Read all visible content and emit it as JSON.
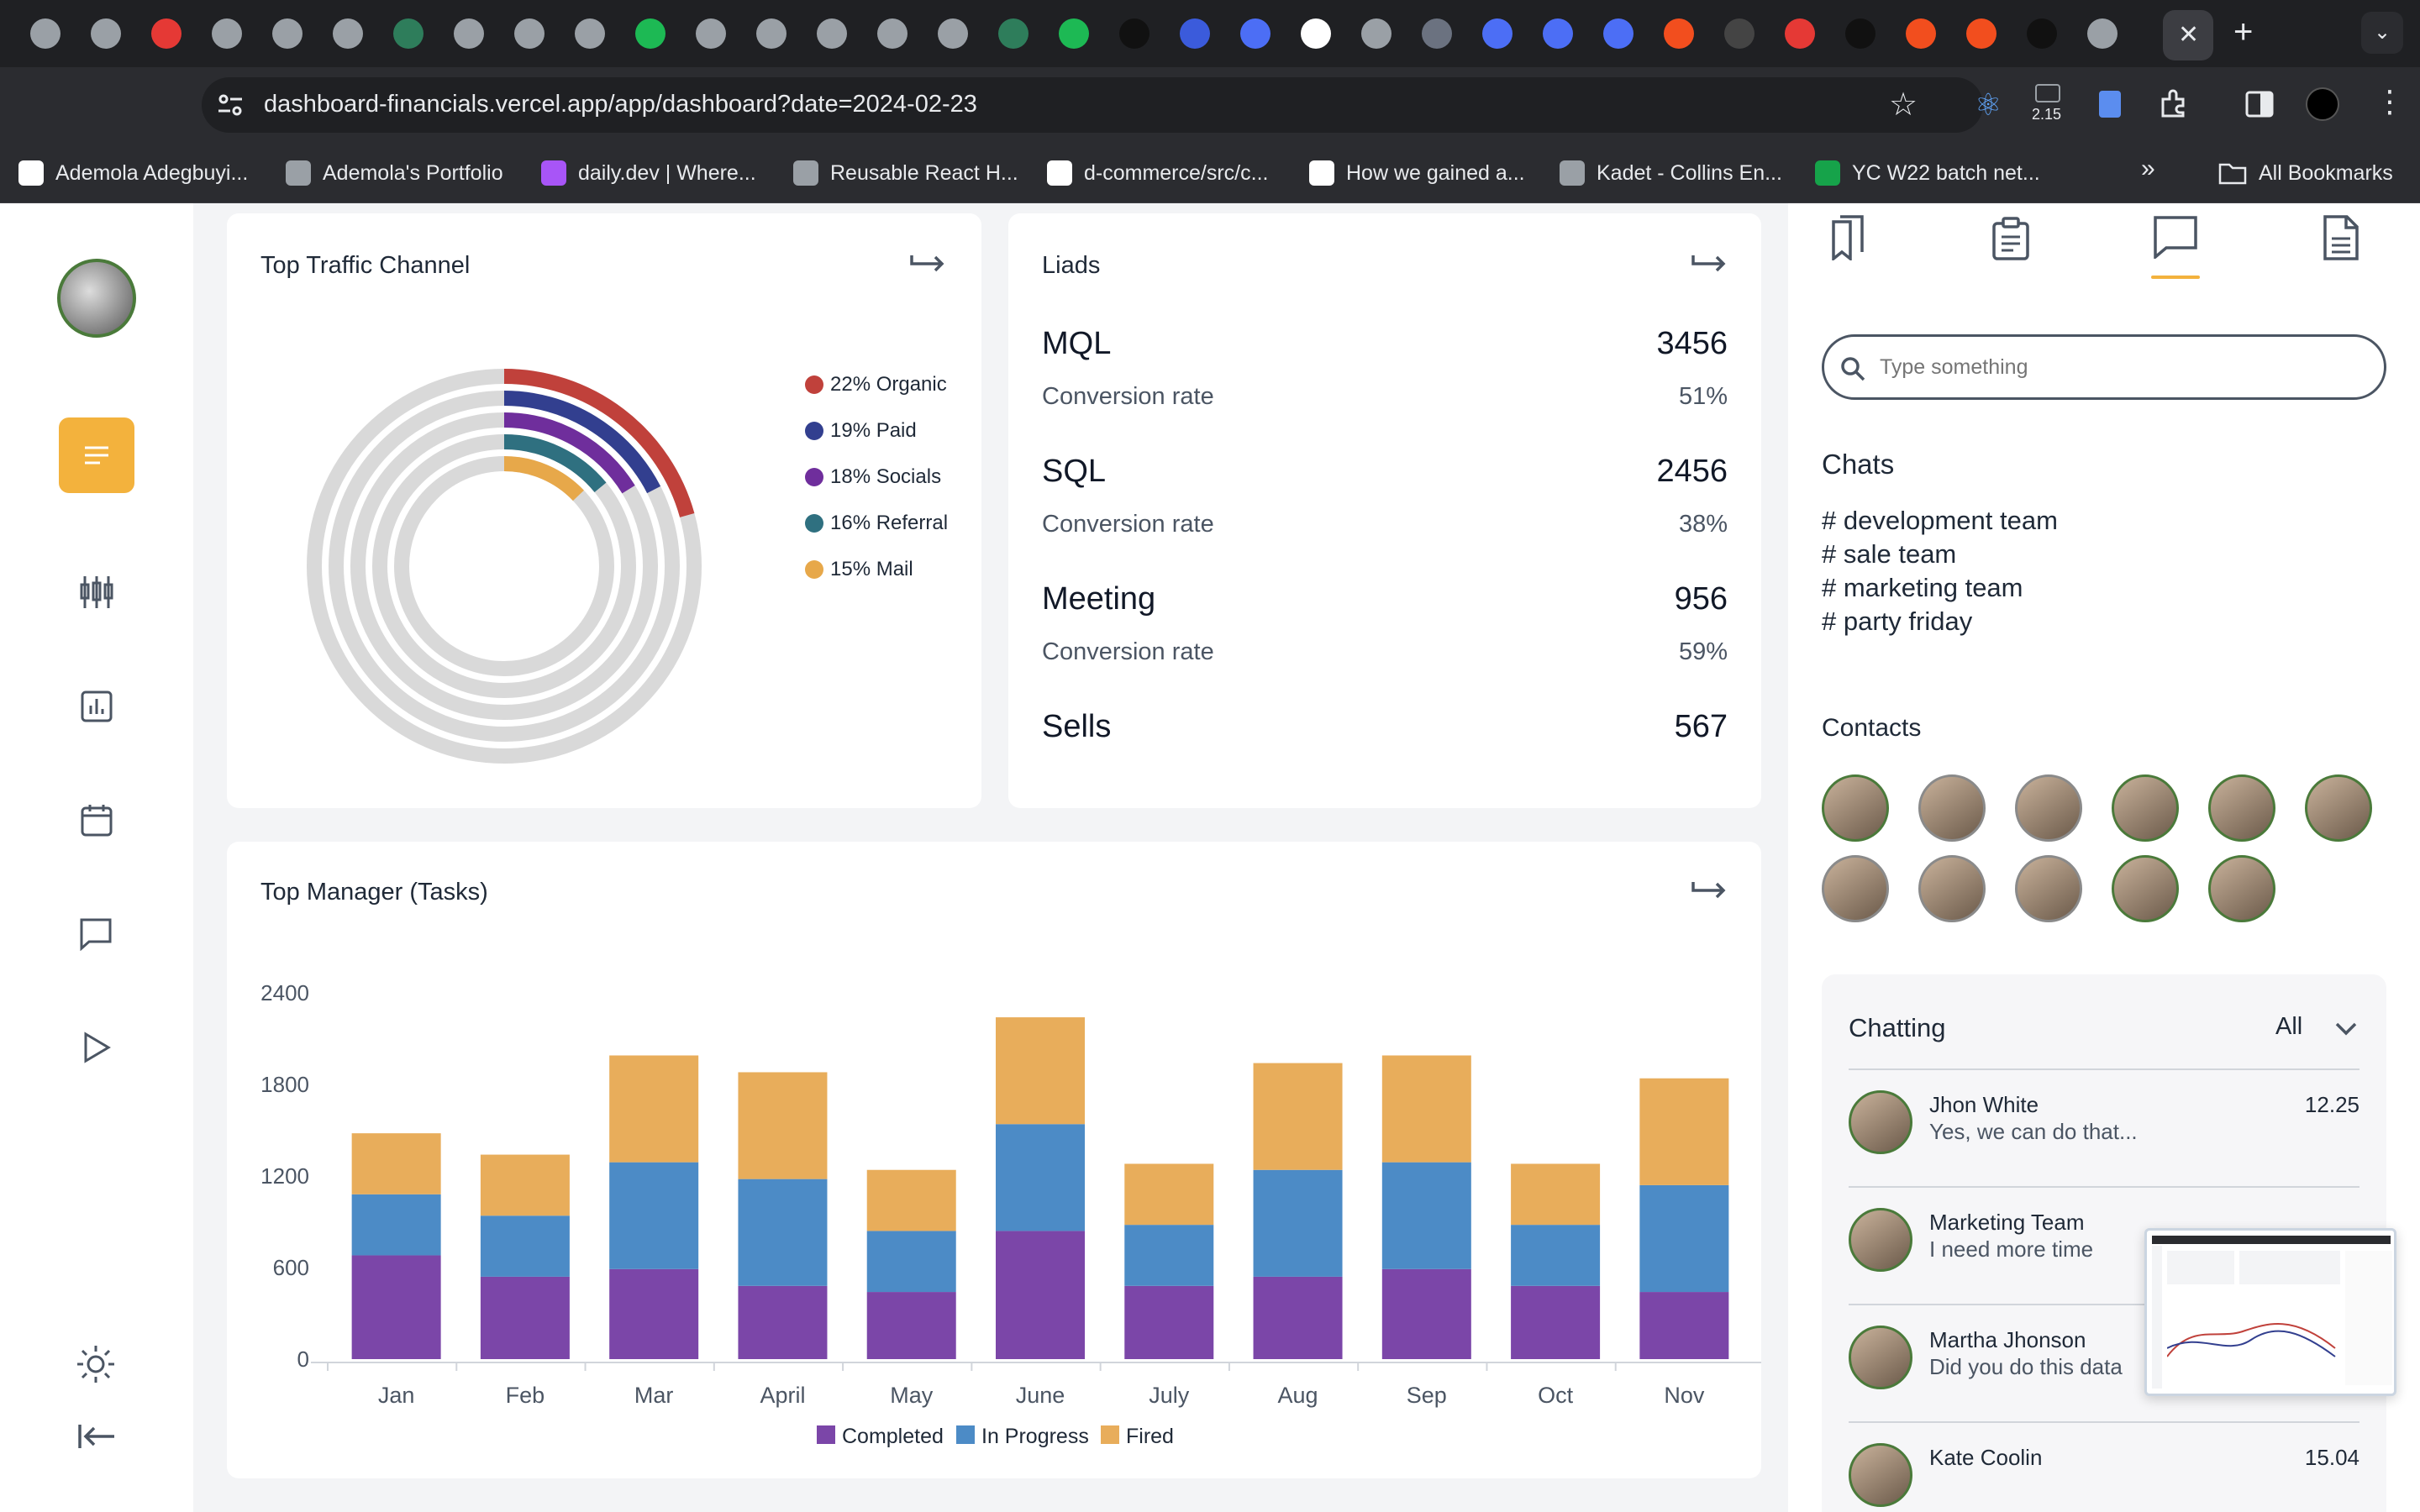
{
  "browser": {
    "url": "dashboard-financials.vercel.app/app/dashboard?date=2024-02-23",
    "ext_badge": "2.15",
    "bookmarks": [
      {
        "label": "Ademola Adegbuyi...",
        "color": "#ffffff"
      },
      {
        "label": "Ademola's Portfolio",
        "color": "#9aa0a6"
      },
      {
        "label": "daily.dev | Where...",
        "color": "#a855f7"
      },
      {
        "label": "Reusable React H...",
        "color": "#9aa0a6"
      },
      {
        "label": "d-commerce/src/c...",
        "color": "#ffffff"
      },
      {
        "label": "How we gained a...",
        "color": "#ffffff"
      },
      {
        "label": "Kadet - Collins En...",
        "color": "#9aa0a6"
      },
      {
        "label": "YC W22 batch net...",
        "color": "#16a34a"
      }
    ],
    "all_bookmarks": "All Bookmarks"
  },
  "traffic": {
    "title": "Top Traffic Channel",
    "legend": [
      {
        "label": "22% Organic",
        "pct": 22,
        "color": "#c0413b"
      },
      {
        "label": "19% Paid",
        "pct": 19,
        "color": "#323f8f"
      },
      {
        "label": "18% Socials",
        "pct": 18,
        "color": "#6f2e9c"
      },
      {
        "label": "16% Referral",
        "pct": 16,
        "color": "#2f7080"
      },
      {
        "label": "15% Mail",
        "pct": 15,
        "color": "#e7a84a"
      }
    ]
  },
  "leads": {
    "title": "Liads",
    "rows": [
      {
        "label": "MQL",
        "value": "3456",
        "rate_label": "Conversion rate",
        "rate": "51%"
      },
      {
        "label": "SQL",
        "value": "2456",
        "rate_label": "Conversion rate",
        "rate": "38%"
      },
      {
        "label": "Meeting",
        "value": "956",
        "rate_label": "Conversion rate",
        "rate": "59%"
      },
      {
        "label": "Sells",
        "value": "567"
      }
    ]
  },
  "managers": {
    "title": "Top Manager (Tasks)"
  },
  "chart_data": {
    "type": "bar",
    "stacked": true,
    "categories": [
      "Jan",
      "Feb",
      "Mar",
      "April",
      "May",
      "June",
      "July",
      "Aug",
      "Sep",
      "Oct",
      "Nov"
    ],
    "series": [
      {
        "name": "Completed",
        "color": "#7b46a8",
        "values": [
          680,
          540,
          590,
          480,
          440,
          840,
          480,
          540,
          590,
          480,
          440
        ]
      },
      {
        "name": "In Progress",
        "color": "#4c8bc6",
        "values": [
          400,
          400,
          700,
          700,
          400,
          700,
          400,
          700,
          700,
          400,
          700
        ]
      },
      {
        "name": "Fired",
        "color": "#e8ad5b",
        "values": [
          400,
          400,
          700,
          700,
          400,
          700,
          400,
          700,
          700,
          400,
          700
        ]
      }
    ],
    "yticks": [
      "0",
      "600",
      "1200",
      "1800",
      "2400"
    ],
    "ylim": [
      0,
      2400
    ],
    "legend_position": "bottom"
  },
  "right": {
    "search_placeholder": "Type something",
    "chats_title": "Chats",
    "channels": [
      "# development team",
      "# sale team",
      "# marketing team",
      "# party friday"
    ],
    "contacts_title": "Contacts",
    "chatting_title": "Chatting",
    "filter": "All",
    "messages": [
      {
        "name": "Jhon White",
        "msg": "Yes, we can do that...",
        "time": "12.25"
      },
      {
        "name": "Marketing Team",
        "msg": "I need more time",
        "time": ""
      },
      {
        "name": "Martha Jhonson",
        "msg": "Did you do this data",
        "time": ""
      },
      {
        "name": "Kate Coolin",
        "msg": "",
        "time": "15.04"
      }
    ]
  }
}
